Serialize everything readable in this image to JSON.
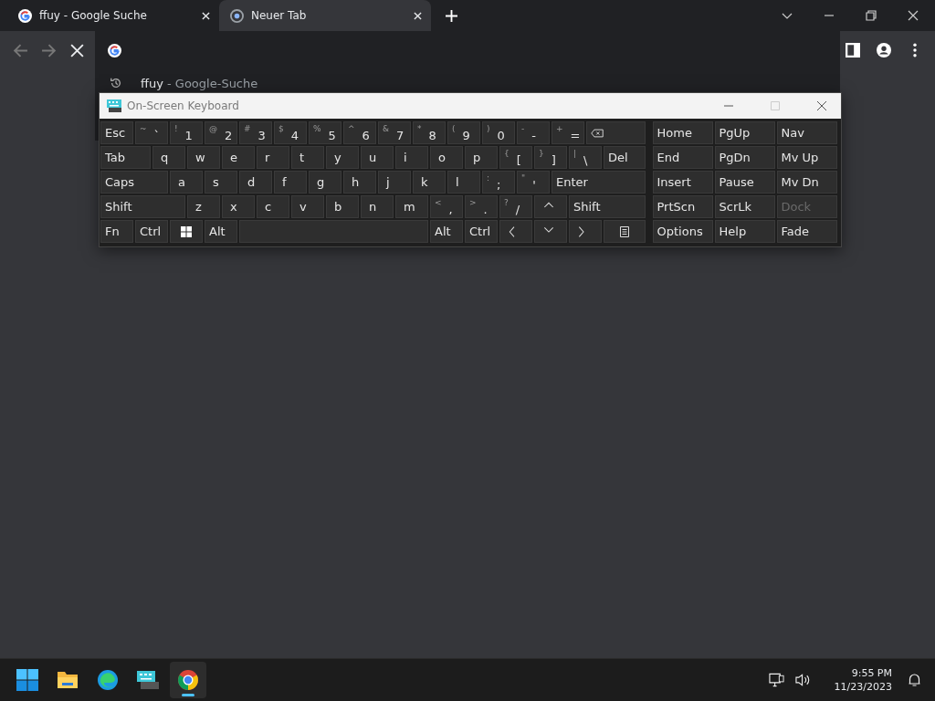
{
  "browser": {
    "tabs": [
      {
        "title": "ffuy - Google Suche",
        "selected": false,
        "kind": "google"
      },
      {
        "title": "Neuer Tab",
        "selected": true,
        "kind": "chrome"
      }
    ],
    "suggestion": {
      "query": "ffuy",
      "suffix": " - Google-Suche"
    }
  },
  "keyboard": {
    "title": "On-Screen Keyboard",
    "main_rows": [
      [
        {
          "kind": "text",
          "label": "Esc"
        },
        {
          "kind": "dual",
          "shift": "~",
          "label": "`"
        },
        {
          "kind": "dual",
          "shift": "!",
          "label": "1"
        },
        {
          "kind": "dual",
          "shift": "@",
          "label": "2"
        },
        {
          "kind": "dual",
          "shift": "#",
          "label": "3"
        },
        {
          "kind": "dual",
          "shift": "$",
          "label": "4"
        },
        {
          "kind": "dual",
          "shift": "%",
          "label": "5"
        },
        {
          "kind": "dual",
          "shift": "^",
          "label": "6"
        },
        {
          "kind": "dual",
          "shift": "&",
          "label": "7"
        },
        {
          "kind": "dual",
          "shift": "*",
          "label": "8"
        },
        {
          "kind": "dual",
          "shift": "(",
          "label": "9"
        },
        {
          "kind": "dual",
          "shift": ")",
          "label": "0"
        },
        {
          "kind": "dual",
          "shift": "-",
          "label": "-"
        },
        {
          "kind": "dual",
          "shift": "+",
          "label": "="
        },
        {
          "kind": "backspace"
        }
      ],
      [
        {
          "kind": "text",
          "label": "Tab"
        },
        {
          "kind": "letter",
          "label": "q"
        },
        {
          "kind": "letter",
          "label": "w"
        },
        {
          "kind": "letter",
          "label": "e"
        },
        {
          "kind": "letter",
          "label": "r"
        },
        {
          "kind": "letter",
          "label": "t"
        },
        {
          "kind": "letter",
          "label": "y"
        },
        {
          "kind": "letter",
          "label": "u"
        },
        {
          "kind": "letter",
          "label": "i"
        },
        {
          "kind": "letter",
          "label": "o"
        },
        {
          "kind": "letter",
          "label": "p"
        },
        {
          "kind": "dual",
          "shift": "{",
          "label": "["
        },
        {
          "kind": "dual",
          "shift": "}",
          "label": "]"
        },
        {
          "kind": "dual",
          "shift": "|",
          "label": "\\"
        },
        {
          "kind": "text",
          "label": "Del"
        }
      ],
      [
        {
          "kind": "text",
          "label": "Caps"
        },
        {
          "kind": "letter",
          "label": "a"
        },
        {
          "kind": "letter",
          "label": "s"
        },
        {
          "kind": "letter",
          "label": "d"
        },
        {
          "kind": "letter",
          "label": "f"
        },
        {
          "kind": "letter",
          "label": "g"
        },
        {
          "kind": "letter",
          "label": "h"
        },
        {
          "kind": "letter",
          "label": "j"
        },
        {
          "kind": "letter",
          "label": "k"
        },
        {
          "kind": "letter",
          "label": "l"
        },
        {
          "kind": "dual",
          "shift": ":",
          "label": ";"
        },
        {
          "kind": "dual",
          "shift": "\"",
          "label": "'"
        },
        {
          "kind": "text",
          "label": "Enter"
        }
      ],
      [
        {
          "kind": "text",
          "label": "Shift"
        },
        {
          "kind": "letter",
          "label": "z"
        },
        {
          "kind": "letter",
          "label": "x"
        },
        {
          "kind": "letter",
          "label": "c"
        },
        {
          "kind": "letter",
          "label": "v"
        },
        {
          "kind": "letter",
          "label": "b"
        },
        {
          "kind": "letter",
          "label": "n"
        },
        {
          "kind": "letter",
          "label": "m"
        },
        {
          "kind": "dual",
          "shift": "<",
          "label": ","
        },
        {
          "kind": "dual",
          "shift": ">",
          "label": "."
        },
        {
          "kind": "dual",
          "shift": "?",
          "label": "/"
        },
        {
          "kind": "up"
        },
        {
          "kind": "text",
          "label": "Shift"
        }
      ],
      [
        {
          "kind": "text",
          "label": "Fn"
        },
        {
          "kind": "text",
          "label": "Ctrl"
        },
        {
          "kind": "windows"
        },
        {
          "kind": "text",
          "label": "Alt"
        },
        {
          "kind": "space"
        },
        {
          "kind": "text",
          "label": "Alt"
        },
        {
          "kind": "text",
          "label": "Ctrl"
        },
        {
          "kind": "left"
        },
        {
          "kind": "down"
        },
        {
          "kind": "right"
        },
        {
          "kind": "menu"
        }
      ]
    ],
    "side_rows": [
      [
        {
          "label": "Home",
          "disabled": false
        },
        {
          "label": "PgUp",
          "disabled": false
        },
        {
          "label": "Nav",
          "disabled": false
        }
      ],
      [
        {
          "label": "End",
          "disabled": false
        },
        {
          "label": "PgDn",
          "disabled": false
        },
        {
          "label": "Mv Up",
          "disabled": false
        }
      ],
      [
        {
          "label": "Insert",
          "disabled": false
        },
        {
          "label": "Pause",
          "disabled": false
        },
        {
          "label": "Mv Dn",
          "disabled": false
        }
      ],
      [
        {
          "label": "PrtScn",
          "disabled": false
        },
        {
          "label": "ScrLk",
          "disabled": false
        },
        {
          "label": "Dock",
          "disabled": true
        }
      ],
      [
        {
          "label": "Options",
          "disabled": false
        },
        {
          "label": "Help",
          "disabled": false
        },
        {
          "label": "Fade",
          "disabled": false
        }
      ]
    ]
  },
  "taskbar": {
    "apps": [
      {
        "kind": "start",
        "active": false
      },
      {
        "kind": "folder",
        "active": false
      },
      {
        "kind": "edge",
        "active": false
      },
      {
        "kind": "keyboard",
        "active": false
      },
      {
        "kind": "chrome",
        "active": true
      }
    ],
    "time": "9:55 PM",
    "date": "11/23/2023"
  }
}
